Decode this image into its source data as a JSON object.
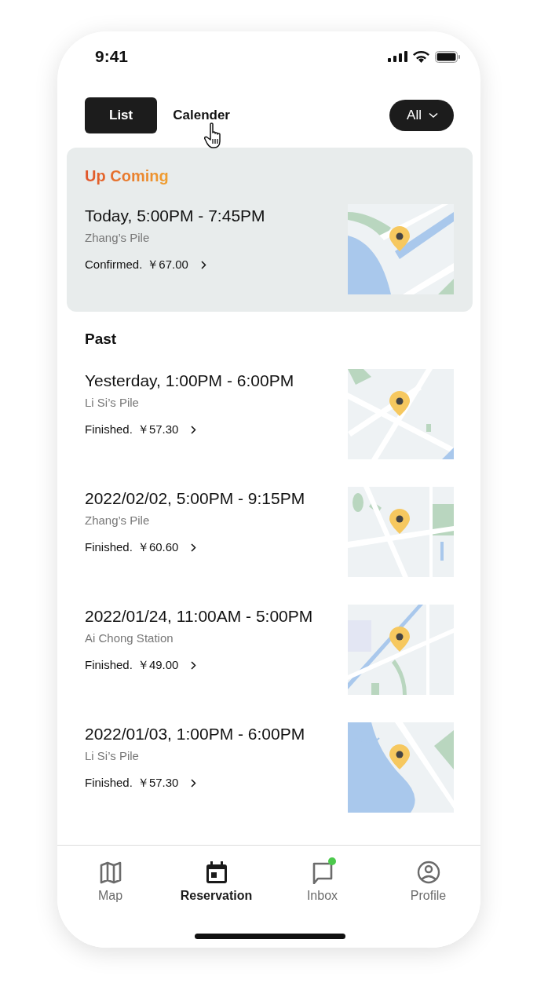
{
  "status_bar": {
    "time": "9:41"
  },
  "view_tabs": [
    {
      "label": "List",
      "selected": true
    },
    {
      "label": "Calender",
      "selected": false
    }
  ],
  "filter": {
    "label": "All"
  },
  "upcoming": {
    "title": "Up Coming",
    "reservations": [
      {
        "time": "Today, 5:00PM - 7:45PM",
        "place": "Zhang’s Pile",
        "status": "Confirmed.",
        "price": "￥67.00"
      }
    ]
  },
  "past": {
    "title": "Past",
    "reservations": [
      {
        "time": "Yesterday, 1:00PM - 6:00PM",
        "place": "Li Si’s Pile",
        "status": "Finished.",
        "price": "￥57.30"
      },
      {
        "time": "2022/02/02, 5:00PM - 9:15PM",
        "place": "Zhang’s Pile",
        "status": "Finished.",
        "price": "￥60.60"
      },
      {
        "time": "2022/01/24, 11:00AM - 5:00PM",
        "place": "Ai Chong Station",
        "status": "Finished.",
        "price": "￥49.00"
      },
      {
        "time": "2022/01/03, 1:00PM - 6:00PM",
        "place": "Li Si’s Pile",
        "status": "Finished.",
        "price": "￥57.30"
      }
    ]
  },
  "tab_bar": [
    {
      "label": "Map",
      "kind": "map",
      "selected": false,
      "unread": false
    },
    {
      "label": "Reservation",
      "kind": "calendar",
      "selected": true,
      "unread": false
    },
    {
      "label": "Inbox",
      "kind": "inbox",
      "selected": false,
      "unread": true
    },
    {
      "label": "Profile",
      "kind": "profile",
      "selected": false,
      "unread": false
    }
  ]
}
